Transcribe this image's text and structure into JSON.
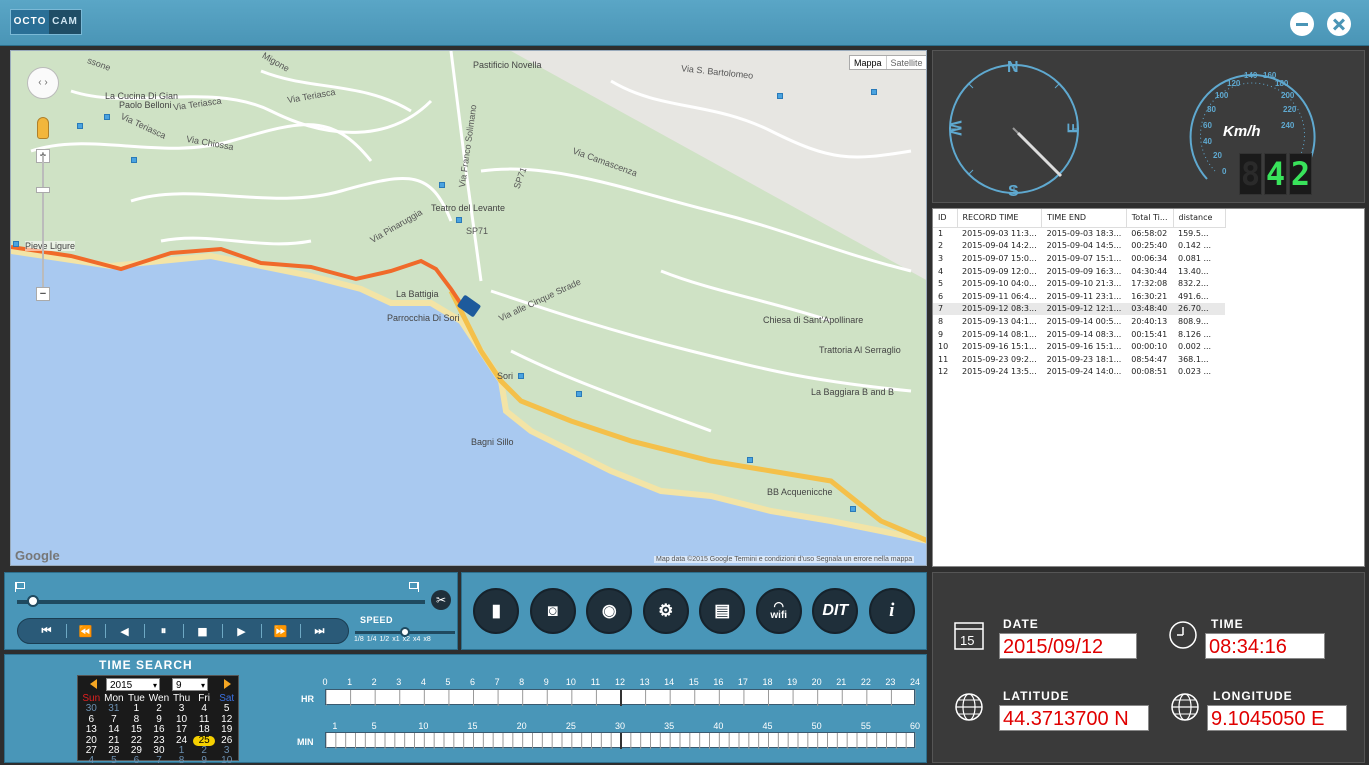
{
  "app": {
    "logo_part1": "OCTO",
    "logo_part2": "CAM"
  },
  "map": {
    "type_map": "Mappa",
    "type_satellite": "Satellite",
    "google": "Google",
    "attribution": "Map data ©2015 Google   Termini e condizioni d'uso   Segnala un errore nella mappa",
    "labels": {
      "pastificio": "Pastificio Novella",
      "bartolomeo": "Via S. Bartolomeo",
      "cucina": "La Cucina Di Gian",
      "cucina2": "Paolo Belloni",
      "teriasca1": "Via Teriasca",
      "teriasca2": "Via Teriasca",
      "teriasca3": "Via Teriasca",
      "chiossa": "Via Chiossa",
      "solimano": "Via Franco Solimano",
      "camascenza": "Via Camascenza",
      "sp71a": "SP71",
      "sp71b": "SP71",
      "teatro": "Teatro del Levante",
      "pinaruggia": "Via Pinaruggia",
      "pieve": "Pieve Ligure",
      "battigia": "La Battigia",
      "cinque": "Via alle Cinque Strade",
      "parrocchia": "Parrocchia Di Sori",
      "apollinare": "Chiesa di Sant'Apollinare",
      "serraglio": "Trattoria Al Serraglio",
      "sori": "Sori",
      "baggiara": "La Baggiara B and B",
      "sillo": "Bagni Sillo",
      "acquenicche": "BB Acquenicche",
      "migone": "Migone",
      "ssone": "ssone"
    }
  },
  "gauges": {
    "compass_n": "N",
    "compass_s": "S",
    "compass_e": "E",
    "compass_w": "W",
    "speed_unit": "Km/h",
    "speed_scale": [
      "0",
      "20",
      "40",
      "60",
      "80",
      "100",
      "120",
      "140",
      "160",
      "180",
      "200",
      "220",
      "240"
    ],
    "speed_value": "42"
  },
  "records": {
    "headers": [
      "ID",
      "RECORD TIME",
      "TIME END",
      "Total Ti...",
      "distance"
    ],
    "rows": [
      [
        "1",
        "2015-09-03 11:3...",
        "2015-09-03 18:3...",
        "06:58:02",
        "159.5..."
      ],
      [
        "2",
        "2015-09-04 14:2...",
        "2015-09-04 14:5...",
        "00:25:40",
        "0.142 ..."
      ],
      [
        "3",
        "2015-09-07 15:0...",
        "2015-09-07 15:1...",
        "00:06:34",
        "0.081 ..."
      ],
      [
        "4",
        "2015-09-09 12:0...",
        "2015-09-09 16:3...",
        "04:30:44",
        "13.40..."
      ],
      [
        "5",
        "2015-09-10 04:0...",
        "2015-09-10 21:3...",
        "17:32:08",
        "832.2..."
      ],
      [
        "6",
        "2015-09-11 06:4...",
        "2015-09-11 23:1...",
        "16:30:21",
        "491.6..."
      ],
      [
        "7",
        "2015-09-12 08:3...",
        "2015-09-12 12:1...",
        "03:48:40",
        "26.70..."
      ],
      [
        "8",
        "2015-09-13 04:1...",
        "2015-09-14 00:5...",
        "20:40:13",
        "808.9..."
      ],
      [
        "9",
        "2015-09-14 08:1...",
        "2015-09-14 08:3...",
        "00:15:41",
        "8.126 ..."
      ],
      [
        "10",
        "2015-09-16 15:1...",
        "2015-09-16 15:1...",
        "00:00:10",
        "0.002 ..."
      ],
      [
        "11",
        "2015-09-23 09:2...",
        "2015-09-23 18:1...",
        "08:54:47",
        "368.1..."
      ],
      [
        "12",
        "2015-09-24 13:5...",
        "2015-09-24 14:0...",
        "00:08:51",
        "0.023 ..."
      ]
    ],
    "selected_index": 6
  },
  "playback": {
    "progress": 0.04,
    "speed_label": "SPEED",
    "speed_options": [
      "1/8",
      "1/4",
      "1/2",
      "x1",
      "x2",
      "x4",
      "x8"
    ],
    "speed_selected": "x1",
    "buttons": {
      "first": "⏮",
      "rewind": "⏪",
      "prev": "◀",
      "pause": "⏸",
      "stop": "■",
      "next": "▶",
      "forward": "⏩",
      "last": "⏭"
    },
    "cut": "✂"
  },
  "toolbar": {
    "sd_card": "▮",
    "hdd": "◙",
    "snapshot": "◉",
    "settings": "⚙",
    "save": "▤",
    "wifi": "wifi",
    "dit": "DIT",
    "info": "i"
  },
  "timesearch": {
    "title": "TIME SEARCH",
    "year": "2015",
    "month": "9",
    "weekdays": [
      "Sun",
      "Mon",
      "Tue",
      "Wen",
      "Thu",
      "Fri",
      "Sat"
    ],
    "days": [
      [
        "30",
        "31",
        "1",
        "2",
        "3",
        "4",
        "5"
      ],
      [
        "6",
        "7",
        "8",
        "9",
        "10",
        "11",
        "12"
      ],
      [
        "13",
        "14",
        "15",
        "16",
        "17",
        "18",
        "19"
      ],
      [
        "20",
        "21",
        "22",
        "23",
        "24",
        "25",
        "26"
      ],
      [
        "27",
        "28",
        "29",
        "30",
        "1",
        "2",
        "3"
      ],
      [
        "4",
        "5",
        "6",
        "7",
        "8",
        "9",
        "10"
      ]
    ],
    "selected_day": "25",
    "hr_label": "HR",
    "min_label": "MIN",
    "hour_ticks": [
      "0",
      "1",
      "2",
      "3",
      "4",
      "5",
      "6",
      "7",
      "8",
      "9",
      "10",
      "11",
      "12",
      "13",
      "14",
      "15",
      "16",
      "17",
      "18",
      "19",
      "20",
      "21",
      "22",
      "23",
      "24"
    ],
    "minute_ticks": [
      "1",
      "5",
      "10",
      "15",
      "20",
      "25",
      "30",
      "35",
      "40",
      "45",
      "50",
      "55",
      "60"
    ],
    "hour_marker": 12,
    "minute_marker": 30
  },
  "info": {
    "date_label": "DATE",
    "date_value": "2015/09/12",
    "date_icon_num": "15",
    "time_label": "TIME",
    "time_value": "08:34:16",
    "lat_label": "LATITUDE",
    "lat_value": "44.3713700 N",
    "lon_label": "LONGITUDE",
    "lon_value": "9.1045050 E"
  }
}
